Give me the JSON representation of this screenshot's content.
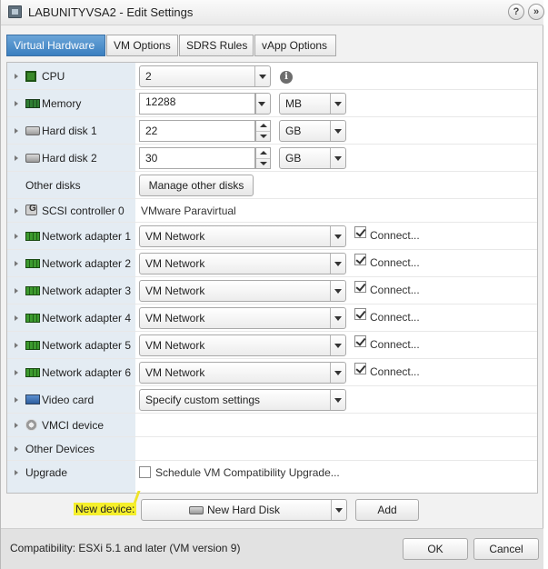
{
  "window": {
    "title": "LABUNITYVSA2 - Edit Settings",
    "help_label": "?",
    "expand_label": "»"
  },
  "tabs": [
    {
      "label": "Virtual Hardware",
      "active": true
    },
    {
      "label": "VM Options",
      "active": false
    },
    {
      "label": "SDRS Rules",
      "active": false
    },
    {
      "label": "vApp Options",
      "active": false
    }
  ],
  "hardware": {
    "cpu": {
      "label": "CPU",
      "value": "2",
      "info_icon": "i"
    },
    "memory": {
      "label": "Memory",
      "value": "12288",
      "unit": "MB"
    },
    "hard_disk_1": {
      "label": "Hard disk 1",
      "value": "22",
      "unit": "GB"
    },
    "hard_disk_2": {
      "label": "Hard disk 2",
      "value": "30",
      "unit": "GB"
    },
    "other_disks": {
      "label": "Other disks",
      "button": "Manage other disks"
    },
    "scsi": {
      "label": "SCSI controller 0",
      "value": "VMware Paravirtual"
    },
    "network_adapters": [
      {
        "label": "Network adapter 1",
        "network": "VM Network",
        "connect": "Connect...",
        "checked": true
      },
      {
        "label": "Network adapter 2",
        "network": "VM Network",
        "connect": "Connect...",
        "checked": true
      },
      {
        "label": "Network adapter 3",
        "network": "VM Network",
        "connect": "Connect...",
        "checked": true
      },
      {
        "label": "Network adapter 4",
        "network": "VM Network",
        "connect": "Connect...",
        "checked": true
      },
      {
        "label": "Network adapter 5",
        "network": "VM Network",
        "connect": "Connect...",
        "checked": true
      },
      {
        "label": "Network adapter 6",
        "network": "VM Network",
        "connect": "Connect...",
        "checked": true
      }
    ],
    "video_card": {
      "label": "Video card",
      "value": "Specify custom settings"
    },
    "vmci": {
      "label": "VMCI device"
    },
    "other_devices": {
      "label": "Other Devices"
    },
    "upgrade": {
      "label": "Upgrade",
      "checkbox_label": "Schedule VM Compatibility Upgrade...",
      "checked": false
    }
  },
  "new_device": {
    "label": "New device:",
    "value": "New Hard Disk",
    "add_button": "Add"
  },
  "footer": {
    "compatibility": "Compatibility: ESXi 5.1 and later (VM version 9)",
    "ok_button": "OK",
    "cancel_button": "Cancel"
  }
}
